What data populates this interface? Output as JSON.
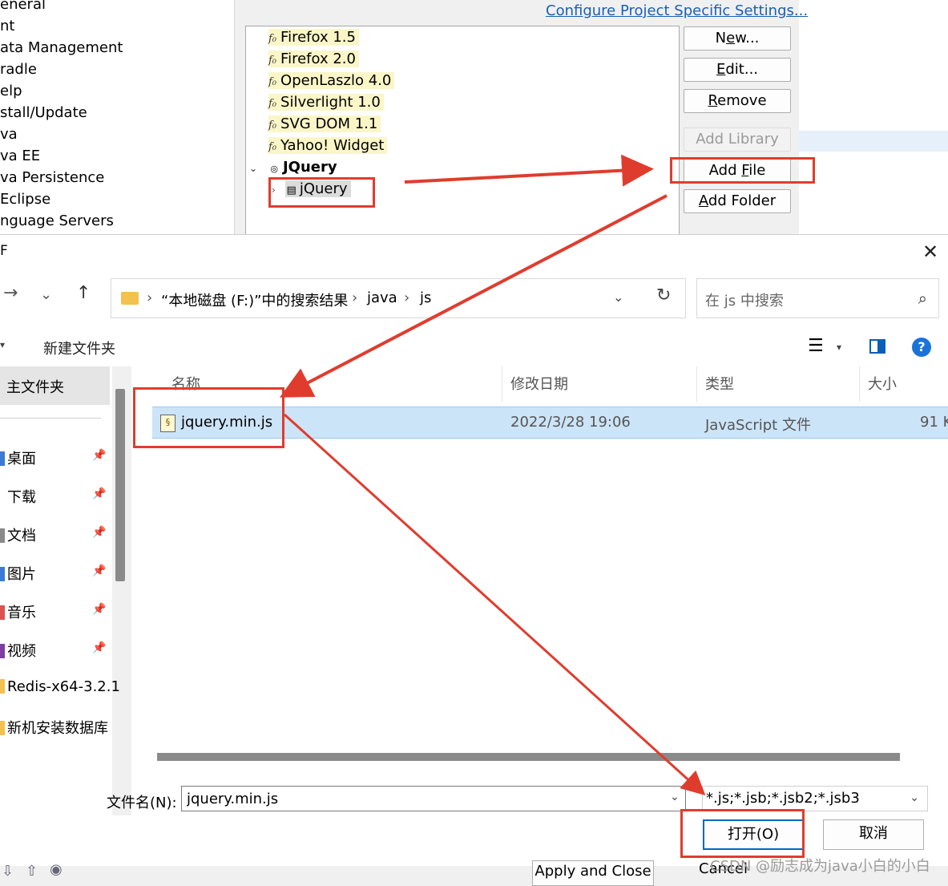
{
  "eclipse": {
    "pref_items": [
      "eneral",
      "nt",
      "ata Management",
      "radle",
      "elp",
      "stall/Update",
      "va",
      "va EE",
      "va Persistence",
      "Eclipse",
      "nguage Servers"
    ],
    "configure_link": "Configure Project Specific Settings...",
    "libraries": [
      "Firefox 1.5",
      "Firefox 2.0",
      "OpenLaszlo 4.0",
      "Silverlight 1.0",
      "SVG DOM 1.1",
      "Yahoo! Widget"
    ],
    "jquery_group": "JQuery",
    "jquery_child": "jQuery",
    "buttons": {
      "new": "New...",
      "edit": "Edit...",
      "remove": "Remove",
      "add_library": "Add Library",
      "add_file": "Add File",
      "add_folder": "Add Folder",
      "apply_close": "Apply and Close",
      "cancel": "Cancel"
    }
  },
  "dialog": {
    "title": "F",
    "close_glyph": "✕",
    "nav": {
      "forward": "→",
      "down": "⌄",
      "up": "↑",
      "refresh": "↻"
    },
    "breadcrumbs": [
      "“本地磁盘 (F:)”中的搜索结果",
      "java",
      "js"
    ],
    "crumb_sep": "›",
    "search_placeholder": "在 js 中搜索",
    "toolbar_new_folder": "新建文件夹",
    "help": "?",
    "nav_home": "主文件夹",
    "nav_items": [
      {
        "label": "桌面",
        "color": "#3a7bd5",
        "pinned": true
      },
      {
        "label": "下载",
        "color": "#ffffff",
        "pinned": true
      },
      {
        "label": "文档",
        "color": "#8a8a8a",
        "pinned": true
      },
      {
        "label": "图片",
        "color": "#3a7bd5",
        "pinned": true
      },
      {
        "label": "音乐",
        "color": "#d9534f",
        "pinned": true
      },
      {
        "label": "视频",
        "color": "#7b3fa0",
        "pinned": true
      },
      {
        "label": "Redis-x64-3.2.1",
        "color": "#f2c14e",
        "pinned": false
      },
      {
        "label": "新机安装数据库",
        "color": "#f2c14e",
        "pinned": false
      }
    ],
    "columns": [
      "名称",
      "修改日期",
      "类型",
      "大小"
    ],
    "file": {
      "name": "jquery.min.js",
      "date": "2022/3/28 19:06",
      "type": "JavaScript 文件",
      "size": "91 K"
    },
    "filename_label": "文件名(N):",
    "filename_value": "jquery.min.js",
    "filter": "*.js;*.jsb;*.jsb2;*.jsb3",
    "open_label": "打开(O)",
    "cancel_label": "取消"
  },
  "watermark": "CSDN @励志成为java小白的小白",
  "colors": {
    "annotation_red": "#e03c2e",
    "selection_blue": "#cce4f7",
    "link_blue": "#1a5fb4"
  }
}
